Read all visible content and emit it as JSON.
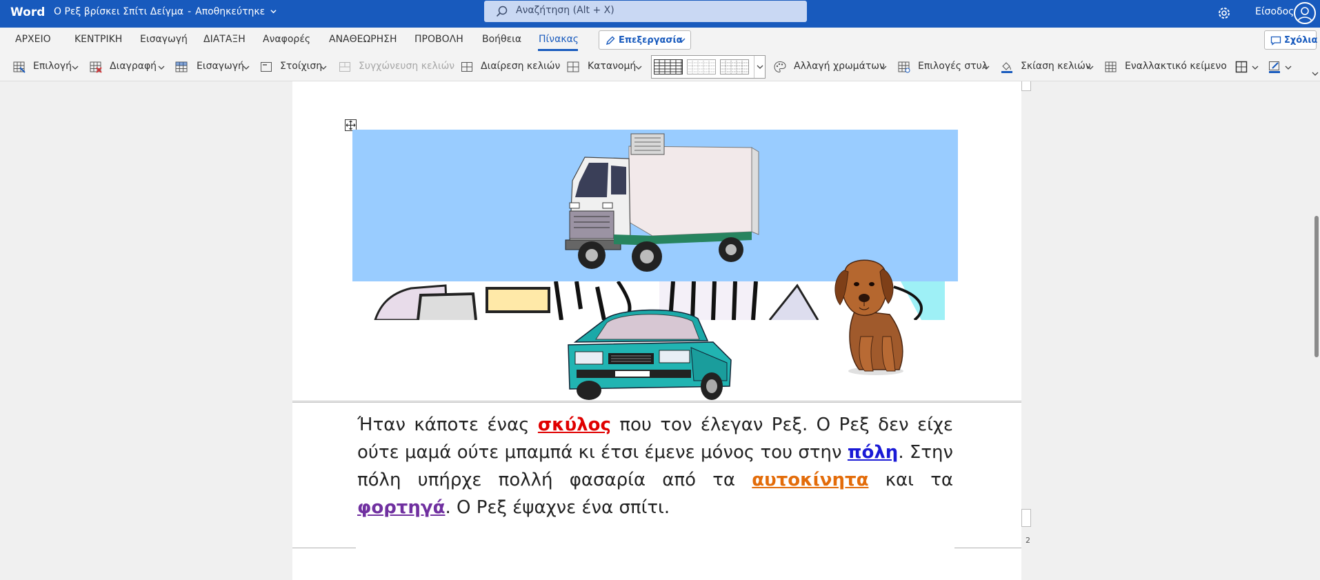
{
  "app": {
    "brand": "Word",
    "doc_title": "Ο Ρεξ βρίσκει Σπίτι Δείγμα",
    "separator": "-",
    "save_state": "Αποθηκεύτηκε",
    "search_placeholder": "Αναζήτηση (Alt + X)",
    "signin_label": "Είσοδος"
  },
  "menu": {
    "items": [
      "ΑΡΧΕΙΟ",
      "ΚΕΝΤΡΙΚΗ",
      "Εισαγωγή",
      "ΔΙΑΤΑΞΗ",
      "Αναφορές",
      "ΑΝΑΘΕΩΡΗΣΗ",
      "ΠΡΟΒΟΛΗ",
      "Βοήθεια",
      "Πίνακας"
    ],
    "active": "Πίνακας",
    "edit_mode_label": "Επεξεργασία",
    "comments_label": "Σχόλια"
  },
  "ribbon": {
    "select": "Επιλογή",
    "delete": "Διαγραφή",
    "insert": "Εισαγωγή",
    "align": "Στοίχιση",
    "merge_cells": "Συγχώνευση κελιών",
    "split_cells": "Διαίρεση κελιών",
    "distribute": "Κατανομή",
    "change_colors": "Αλλαγή χρωμάτων",
    "style_options": "Επιλογές στυλ",
    "cell_shading": "Σκίαση κελιών",
    "alt_text": "Εναλλακτικό κείμενο"
  },
  "document": {
    "story": {
      "t1": "Ήταν κάποτε ένας ",
      "k1": "σκύλος",
      "t2": " που τον έλεγαν Ρεξ. Ο Ρεξ δεν είχε ούτε μαμά ούτε μπαμπά κι έτσι έμενε μόνος του στην ",
      "k2": "πόλη",
      "t3": ". Στην πόλη υπήρχε πολλή φασαρία από τα ",
      "k3": "αυτοκίνητα",
      "t4": " και τα ",
      "k4": "φορτηγά",
      "t5": ". Ο Ρεξ έψαχνε ένα σπίτι."
    },
    "page_number": "2",
    "keyword_colors": {
      "dog": "#e00000",
      "city": "#1a1ad6",
      "cars": "#e36c0a",
      "trucks": "#7030a0"
    },
    "truck_cell_color": "#99ccff"
  },
  "icons": [
    "search-icon",
    "gear-icon",
    "user-avatar-icon",
    "pencil-icon",
    "comment-icon",
    "table-move-handle-icon"
  ]
}
